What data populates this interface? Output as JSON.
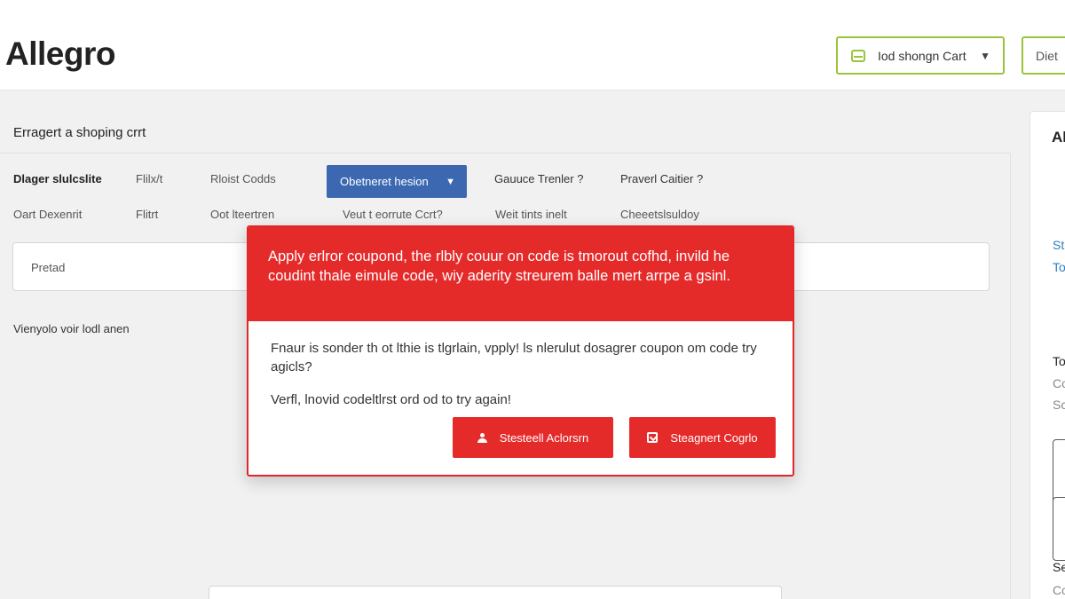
{
  "header": {
    "logo": "Allegro",
    "cart_button_label": "Iod shongn Cart",
    "extra_button_label": "Diet"
  },
  "main": {
    "title": "Erragert a shoping crrt",
    "options_row1": [
      "Dlager slulcslite",
      "Flilx/t",
      "Rloist Codds",
      "Gauuce Trenler ?",
      "Praverl Caitier ?"
    ],
    "selected_option": "Obetneret hesion",
    "options_row2": [
      "Oart Dexenrit",
      "Flitrt",
      "Oot lteertren",
      "Veut t eorrute Ccrt?",
      "Weit tints inelt",
      "Cheeetslsuldoy"
    ],
    "input_value": "Pretad",
    "section_note": "Vienyolo voir lodl anen"
  },
  "modal": {
    "header_text": "Apply erlror coupond, the rlbly couur on code is tmorout cofhd, invild he coudint thale eimule code, wiy aderity streurem balle mert arrpe a gsinl.",
    "body_line1": "Fnaur is sonder th ot lthie is tlgrlain, vpply! ls nlerulut dosagrer coupon om code try agicls?",
    "body_line2": "Verfl, lnovid codeltlrst ord od to try again!",
    "primary_button": "Stesteell Aclorsrn",
    "secondary_button": "Steagnert Cogrlo"
  },
  "side": {
    "title": "Al",
    "link1": "St",
    "link2": "To",
    "heading": "To",
    "line1": "Cc",
    "line2": "Sc",
    "bottom1": "Se",
    "bottom2": "Cc"
  },
  "colors": {
    "accent_green": "#9ac43b",
    "primary_blue": "#3b68b0",
    "error_red": "#e52a2a",
    "link_blue": "#2a7fbf"
  },
  "icons": [
    "cart-icon",
    "chevron-down-icon",
    "user-icon",
    "checkbox-icon"
  ]
}
